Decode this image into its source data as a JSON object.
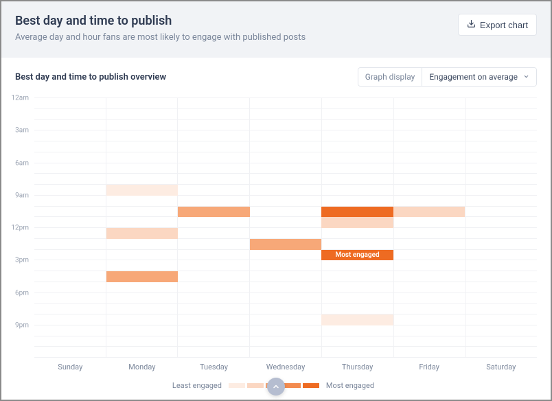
{
  "header": {
    "title": "Best day and time to publish",
    "subtitle": "Average day and hour fans are most likely to engage with published posts",
    "export_label": "Export chart"
  },
  "subheader": {
    "title": "Best day and time to publish overview",
    "graph_display_label": "Graph display",
    "graph_display_value": "Engagement on average"
  },
  "chart_data": {
    "type": "heatmap",
    "title": "Best day and time to publish overview",
    "xlabel": "",
    "ylabel": "",
    "days": [
      "Sunday",
      "Monday",
      "Tuesday",
      "Wednesday",
      "Thursday",
      "Friday",
      "Saturday"
    ],
    "y_ticks": [
      {
        "hour": 0,
        "label": "12am"
      },
      {
        "hour": 3,
        "label": "3am"
      },
      {
        "hour": 6,
        "label": "6am"
      },
      {
        "hour": 9,
        "label": "9am"
      },
      {
        "hour": 12,
        "label": "12pm"
      },
      {
        "hour": 15,
        "label": "3pm"
      },
      {
        "hour": 18,
        "label": "6pm"
      },
      {
        "hour": 21,
        "label": "9pm"
      }
    ],
    "intensity_scale": [
      0,
      1,
      2,
      3,
      4
    ],
    "intensity_colors": [
      "#fdece2",
      "#fbd7c2",
      "#f7a878",
      "#f38b4f",
      "#ee6b22"
    ],
    "legend": {
      "low": "Least engaged",
      "high": "Most engaged"
    },
    "peak_label": "Most engaged",
    "cells": [
      {
        "day": "Monday",
        "hour": 8,
        "intensity": 0
      },
      {
        "day": "Monday",
        "hour": 12,
        "intensity": 1
      },
      {
        "day": "Monday",
        "hour": 16,
        "intensity": 2
      },
      {
        "day": "Tuesday",
        "hour": 10,
        "intensity": 2
      },
      {
        "day": "Wednesday",
        "hour": 13,
        "intensity": 2
      },
      {
        "day": "Thursday",
        "hour": 10,
        "intensity": 4
      },
      {
        "day": "Thursday",
        "hour": 11,
        "intensity": 1
      },
      {
        "day": "Thursday",
        "hour": 14,
        "intensity": 4,
        "peak": true
      },
      {
        "day": "Thursday",
        "hour": 20,
        "intensity": 0
      },
      {
        "day": "Friday",
        "hour": 10,
        "intensity": 1
      }
    ]
  }
}
